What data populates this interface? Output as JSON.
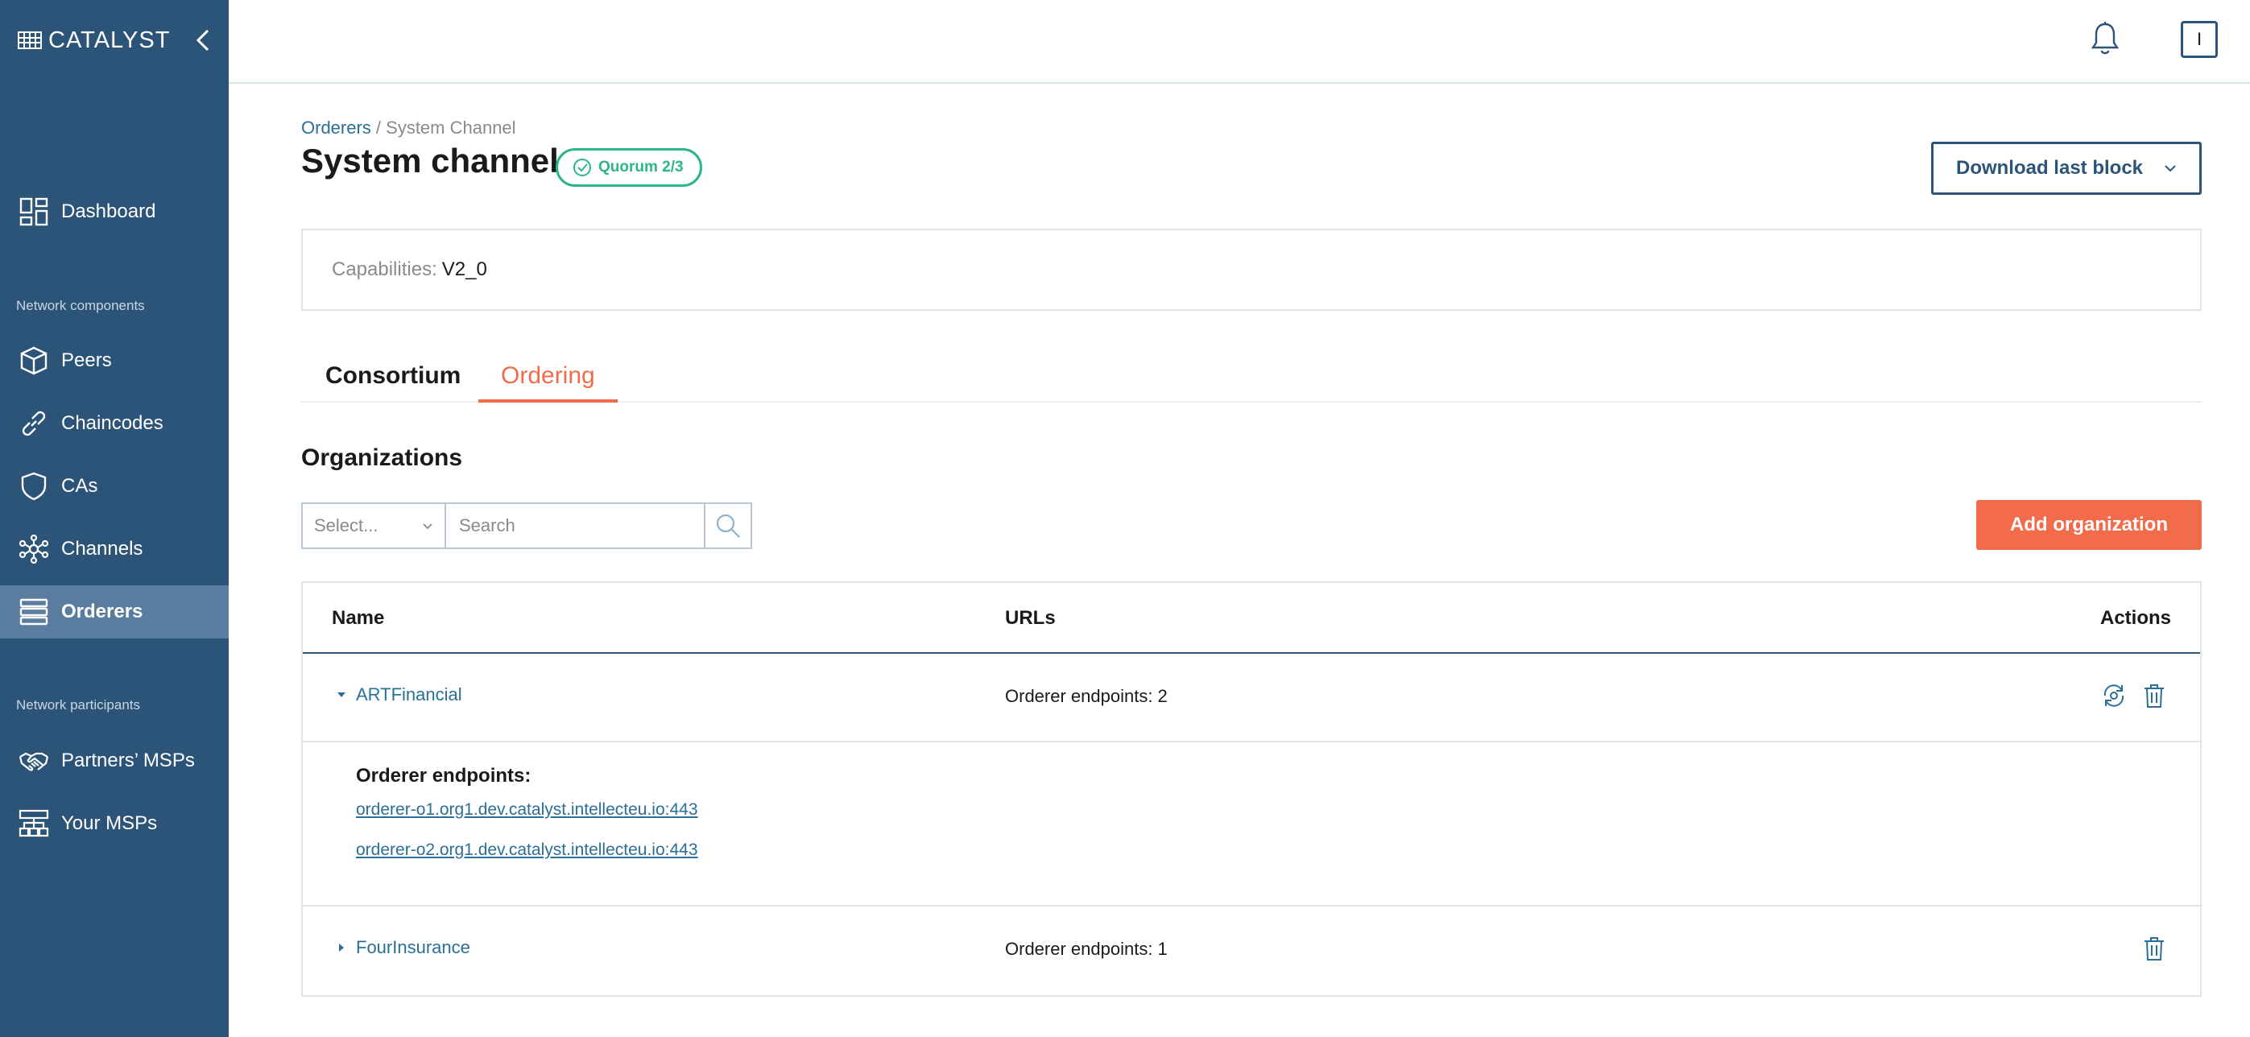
{
  "app": {
    "logo_text": "CATALYST"
  },
  "sidebar": {
    "items": [
      {
        "label": "Dashboard",
        "icon": "dashboard-icon"
      },
      {
        "label": "Peers",
        "icon": "cube-icon"
      },
      {
        "label": "Chaincodes",
        "icon": "link-icon"
      },
      {
        "label": "CAs",
        "icon": "shield-icon"
      },
      {
        "label": "Channels",
        "icon": "network-icon"
      },
      {
        "label": "Orderers",
        "icon": "server-icon",
        "active": true
      },
      {
        "label": "Partners’ MSPs",
        "icon": "handshake-icon"
      },
      {
        "label": "Your MSPs",
        "icon": "hierarchy-icon"
      }
    ],
    "section_network_components": "Network components",
    "section_network_participants": "Network participants"
  },
  "header": {
    "user_initial": "I"
  },
  "breadcrumb": {
    "parent": "Orderers",
    "separator": " / ",
    "current": "System Channel"
  },
  "page": {
    "title": "System channel",
    "quorum_label": "Quorum 2/3",
    "download_label": "Download last block"
  },
  "capabilities": {
    "label": "Capabilities:",
    "value": "V2_0"
  },
  "tabs": [
    {
      "label": "Consortium",
      "active": false
    },
    {
      "label": "Ordering",
      "active": true
    }
  ],
  "organizations": {
    "title": "Organizations",
    "select_placeholder": "Select...",
    "search_placeholder": "Search",
    "add_label": "Add organization",
    "columns": {
      "name": "Name",
      "urls": "URLs",
      "actions": "Actions"
    },
    "rows": [
      {
        "name": "ARTFinancial",
        "urls": "Orderer endpoints: 2",
        "expanded": true,
        "endpoints_title": "Orderer endpoints:",
        "endpoints": [
          "orderer-o1.org1.dev.catalyst.intellecteu.io:443",
          "orderer-o2.org1.dev.catalyst.intellecteu.io:443"
        ]
      },
      {
        "name": "FourInsurance",
        "urls": "Orderer endpoints: 1",
        "expanded": false
      }
    ]
  },
  "colors": {
    "sidebar": "#2c5478",
    "sidebar_active": "#5a7d9f",
    "accent": "#f26b4a",
    "success": "#2bb58a",
    "link": "#2a6f97"
  }
}
